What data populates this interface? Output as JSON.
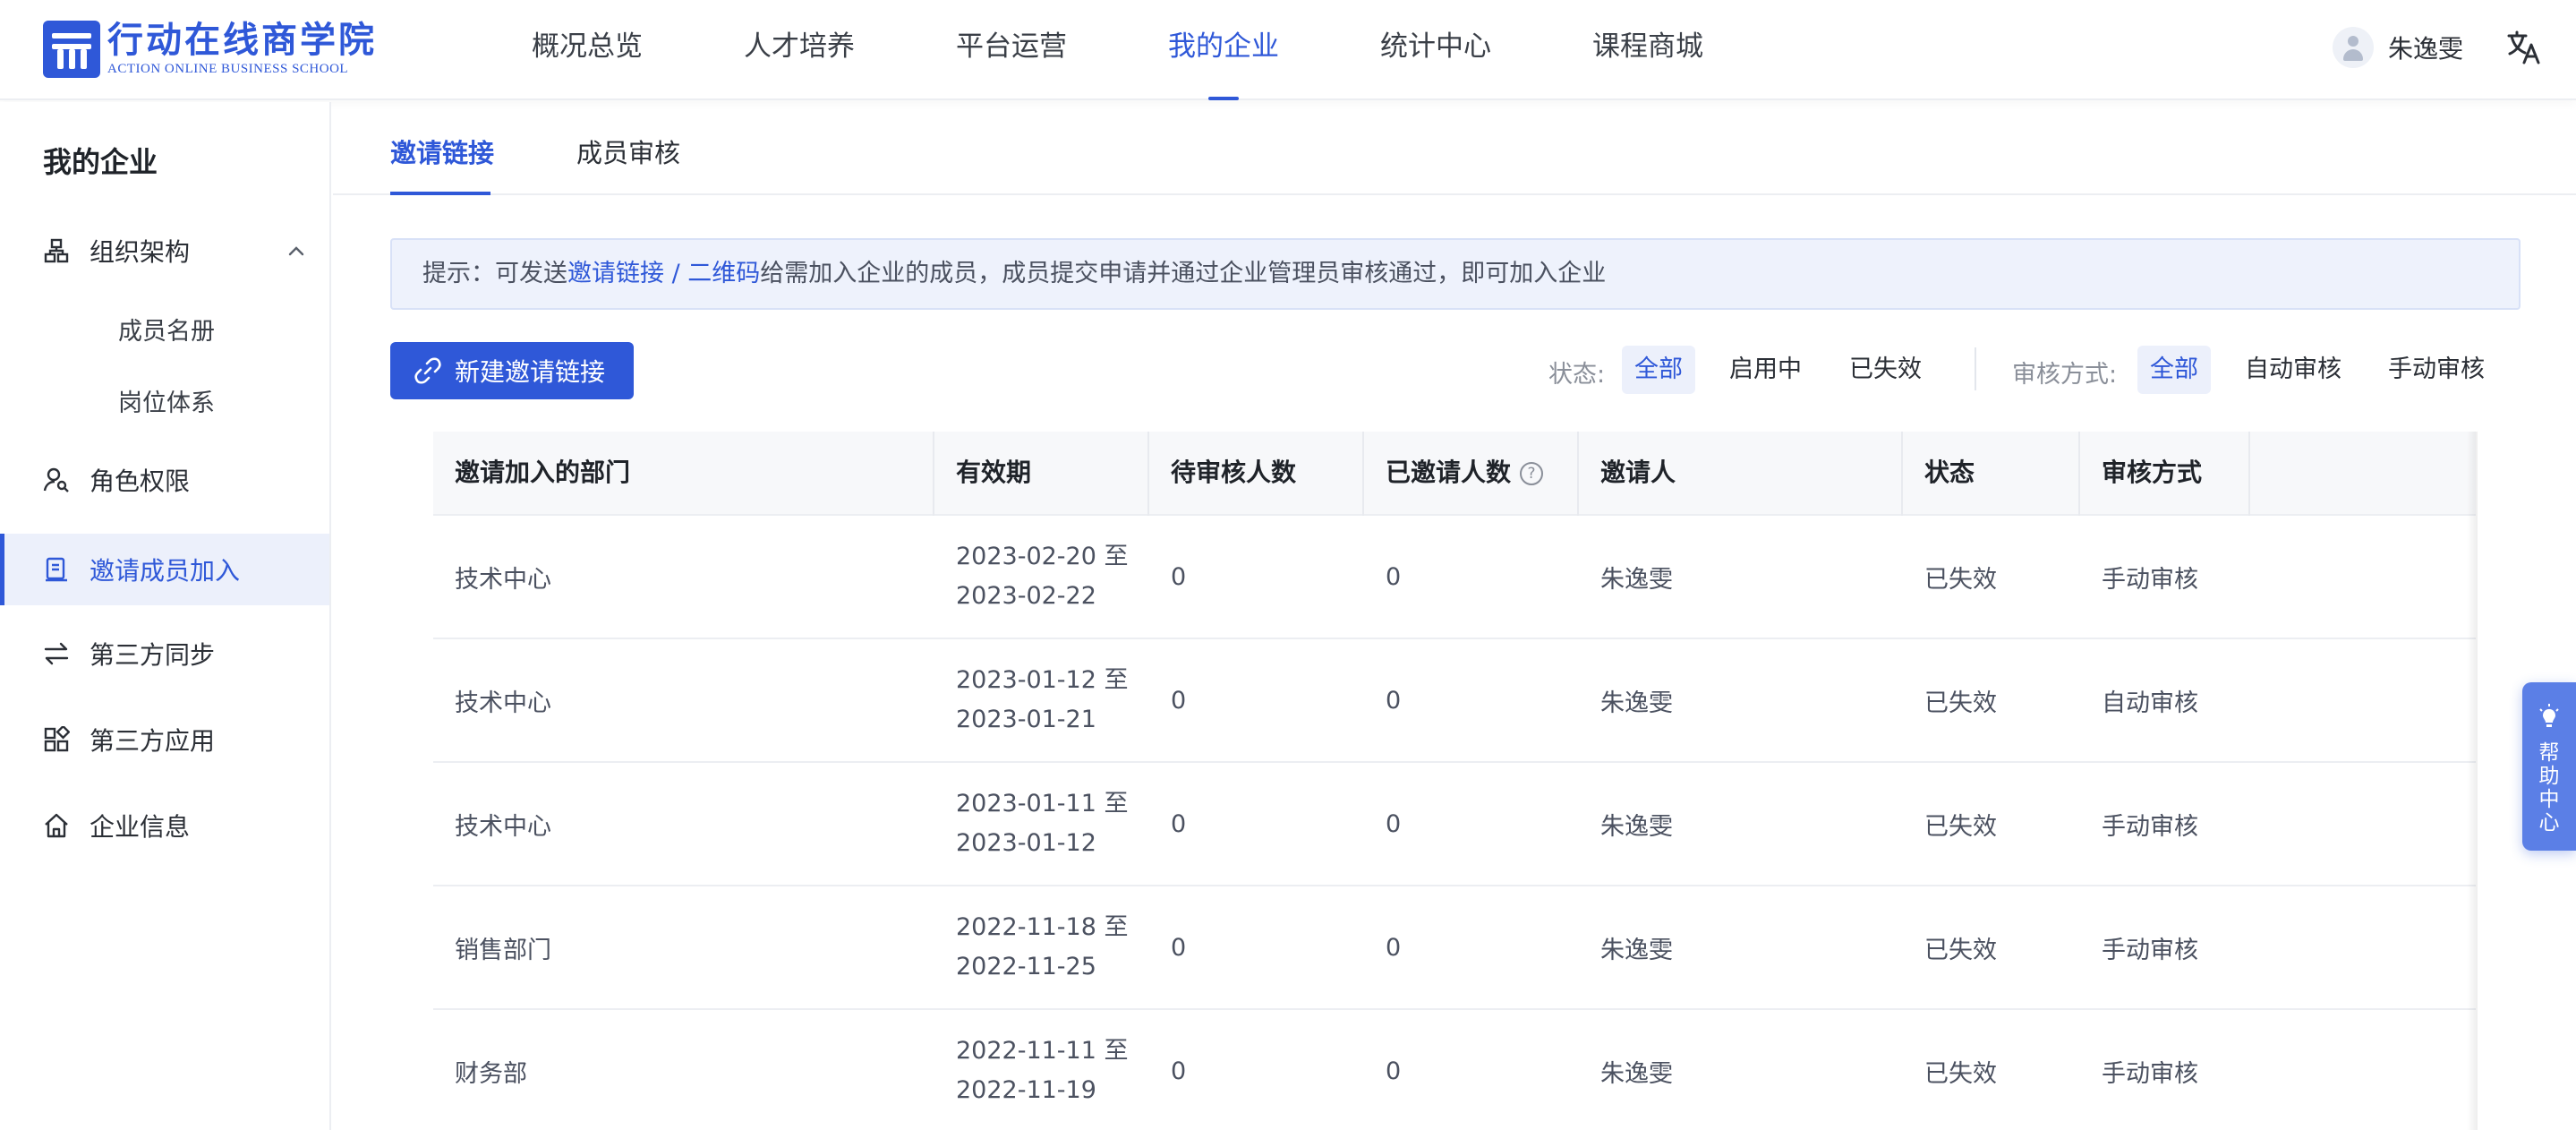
{
  "brand": {
    "name_cn": "行动在线商学院",
    "name_en": "ACTION ONLINE BUSINESS SCHOOL",
    "color": "#2f58d8"
  },
  "nav": {
    "items": [
      {
        "label": "概况总览"
      },
      {
        "label": "人才培养"
      },
      {
        "label": "平台运营"
      },
      {
        "label": "我的企业",
        "active": true
      },
      {
        "label": "统计中心"
      },
      {
        "label": "课程商城"
      }
    ]
  },
  "user": {
    "name": "朱逸雯",
    "avatar_icon": "user-avatar-icon",
    "translate_icon": "translate-icon"
  },
  "sidebar": {
    "title": "我的企业",
    "items": [
      {
        "label": "组织架构",
        "icon": "org-chart-icon",
        "expanded": true
      },
      {
        "label": "成员名册",
        "sub": true
      },
      {
        "label": "岗位体系",
        "sub": true
      },
      {
        "label": "角色权限",
        "icon": "user-key-icon"
      },
      {
        "label": "邀请成员加入",
        "icon": "invite-icon",
        "active": true
      },
      {
        "label": "第三方同步",
        "icon": "sync-icon"
      },
      {
        "label": "第三方应用",
        "icon": "apps-icon"
      },
      {
        "label": "企业信息",
        "icon": "home-icon"
      }
    ]
  },
  "tabs": [
    {
      "label": "邀请链接",
      "active": true
    },
    {
      "label": "成员审核"
    }
  ],
  "tip": {
    "prefix": "提示：可发送",
    "link1": "邀请链接",
    "separator": " / ",
    "link2": "二维码",
    "suffix": "给需加入企业的成员，成员提交申请并通过企业管理员审核通过，即可加入企业"
  },
  "toolbar": {
    "new_label": "新建邀请链接",
    "status_label": "状态:",
    "status_options": [
      "全部",
      "启用中",
      "已失效"
    ],
    "status_selected": "全部",
    "review_label": "审核方式:",
    "review_options": [
      "全部",
      "自动审核",
      "手动审核"
    ],
    "review_selected": "全部"
  },
  "table": {
    "columns": [
      "邀请加入的部门",
      "有效期",
      "待审核人数",
      "已邀请人数",
      "邀请人",
      "状态",
      "审核方式"
    ],
    "help_mark": "?",
    "rows": [
      {
        "dept": "技术中心",
        "date_from": "2023-02-20 至",
        "date_to": "2023-02-22",
        "pending": "0",
        "invited": "0",
        "inviter": "朱逸雯",
        "status": "已失效",
        "review": "手动审核"
      },
      {
        "dept": "技术中心",
        "date_from": "2023-01-12 至",
        "date_to": "2023-01-21",
        "pending": "0",
        "invited": "0",
        "inviter": "朱逸雯",
        "status": "已失效",
        "review": "自动审核"
      },
      {
        "dept": "技术中心",
        "date_from": "2023-01-11 至",
        "date_to": "2023-01-12",
        "pending": "0",
        "invited": "0",
        "inviter": "朱逸雯",
        "status": "已失效",
        "review": "手动审核"
      },
      {
        "dept": "销售部门",
        "date_from": "2022-11-18 至",
        "date_to": "2022-11-25",
        "pending": "0",
        "invited": "0",
        "inviter": "朱逸雯",
        "status": "已失效",
        "review": "手动审核"
      },
      {
        "dept": "财务部",
        "date_from": "2022-11-11 至",
        "date_to": "2022-11-19",
        "pending": "0",
        "invited": "0",
        "inviter": "朱逸雯",
        "status": "已失效",
        "review": "手动审核"
      }
    ]
  },
  "help_float": {
    "chars": [
      "帮",
      "助",
      "中",
      "心"
    ],
    "icon": "lightbulb-icon"
  }
}
